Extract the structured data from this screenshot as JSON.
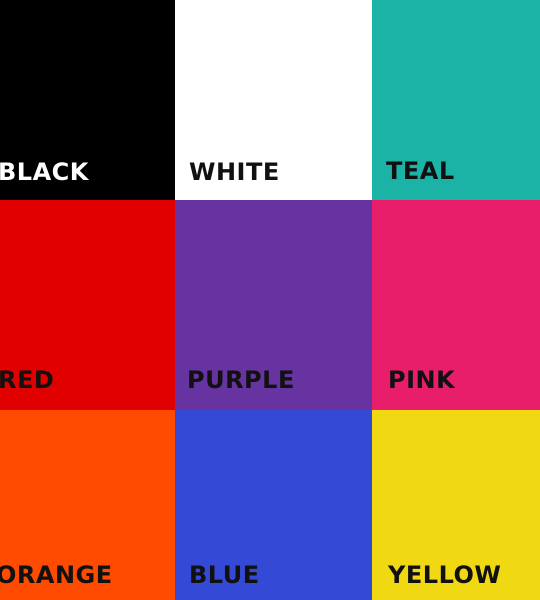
{
  "swatches": [
    {
      "id": "black",
      "label": "BLACK",
      "color": "#000000",
      "text_color": "#ffffff"
    },
    {
      "id": "white",
      "label": "WHITE",
      "color": "#ffffff",
      "text_color": "#111111"
    },
    {
      "id": "teal",
      "label": "TEAL",
      "color": "#1ab3a6",
      "text_color": "#111111"
    },
    {
      "id": "red",
      "label": "RED",
      "color": "#e00000",
      "text_color": "#111111"
    },
    {
      "id": "purple",
      "label": "PURPLE",
      "color": "#6633a0",
      "text_color": "#111111"
    },
    {
      "id": "pink",
      "label": "PINK",
      "color": "#e91e6b",
      "text_color": "#111111"
    },
    {
      "id": "orange",
      "label": "ORANGE",
      "color": "#ff4b00",
      "text_color": "#111111"
    },
    {
      "id": "blue",
      "label": "BLUE",
      "color": "#344ad6",
      "text_color": "#111111"
    },
    {
      "id": "yellow",
      "label": "YELLOW",
      "color": "#f0d813",
      "text_color": "#111111"
    }
  ]
}
